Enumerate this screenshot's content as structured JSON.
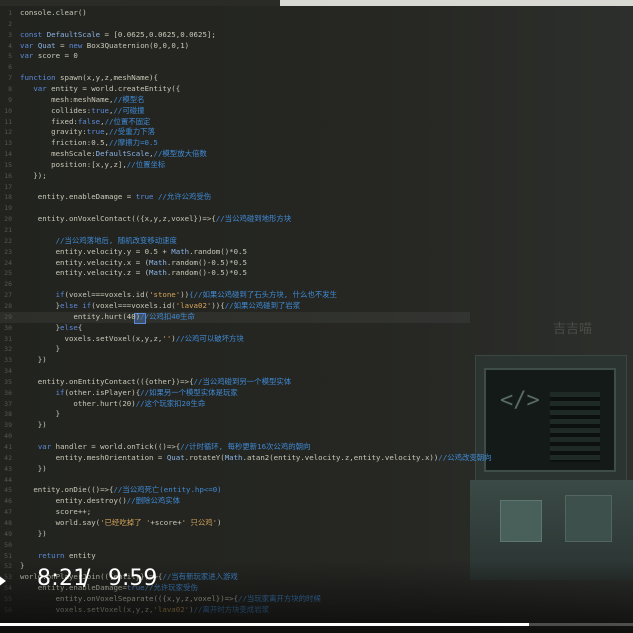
{
  "player": {
    "time_current": "8:21",
    "time_separator": "/",
    "time_total": "9:59",
    "progress_fraction": 0.836
  },
  "watermark": "吉吉喵",
  "editor": {
    "active_line": 29,
    "lines": [
      {
        "n": "1",
        "parts": [
          [
            "",
            "console.clear()"
          ]
        ]
      },
      {
        "n": "2",
        "parts": [
          [
            "",
            ""
          ]
        ]
      },
      {
        "n": "3",
        "parts": [
          [
            "kw",
            "const "
          ],
          [
            "cls",
            "DefaultScale"
          ],
          [
            "",
            "",
            " = [0.0625,0.0625,0.0625];"
          ]
        ]
      },
      {
        "n": "4",
        "parts": [
          [
            "kw",
            "var "
          ],
          [
            "cls",
            "Quat"
          ],
          [
            "",
            " = "
          ],
          [
            "kw",
            "new "
          ],
          [
            "",
            "Box3Quaternion(0,0,0,1)"
          ]
        ]
      },
      {
        "n": "5",
        "parts": [
          [
            "kw",
            "var "
          ],
          [
            "",
            "score = 0"
          ]
        ]
      },
      {
        "n": "6",
        "parts": [
          [
            "",
            ""
          ]
        ]
      },
      {
        "n": "7",
        "parts": [
          [
            "kw",
            "function "
          ],
          [
            "",
            "spawn(x,y,z,meshName){"
          ]
        ]
      },
      {
        "n": "8",
        "parts": [
          [
            "",
            "   "
          ],
          [
            "kw",
            "var "
          ],
          [
            "",
            "entity = world.createEntity({"
          ]
        ]
      },
      {
        "n": "9",
        "parts": [
          [
            "",
            "       mesh:meshName,"
          ],
          [
            "cm",
            "//模型名"
          ]
        ]
      },
      {
        "n": "10",
        "parts": [
          [
            "",
            "       collides:"
          ],
          [
            "kw",
            "true"
          ],
          [
            "",
            ","
          ],
          [
            "cm",
            "//可碰撞"
          ]
        ]
      },
      {
        "n": "11",
        "parts": [
          [
            "",
            "       fixed:"
          ],
          [
            "kw",
            "false"
          ],
          [
            "",
            ","
          ],
          [
            "cm",
            "//位置不固定"
          ]
        ]
      },
      {
        "n": "12",
        "parts": [
          [
            "",
            "       gravity:"
          ],
          [
            "kw",
            "true"
          ],
          [
            "",
            ","
          ],
          [
            "cm",
            "//受重力下落"
          ]
        ]
      },
      {
        "n": "13",
        "parts": [
          [
            "",
            "       friction:0.5,"
          ],
          [
            "cm",
            "//摩擦力=0.5"
          ]
        ]
      },
      {
        "n": "14",
        "parts": [
          [
            "",
            "       meshScale:"
          ],
          [
            "cls",
            "DefaultScale"
          ],
          [
            "",
            ","
          ],
          [
            "cm",
            "//模型放大倍数"
          ]
        ]
      },
      {
        "n": "15",
        "parts": [
          [
            "",
            "       position:[x,y,z],"
          ],
          [
            "cm",
            "//位置坐标"
          ]
        ]
      },
      {
        "n": "16",
        "parts": [
          [
            "",
            "   });"
          ]
        ]
      },
      {
        "n": "17",
        "parts": [
          [
            "",
            ""
          ]
        ]
      },
      {
        "n": "18",
        "parts": [
          [
            "",
            "    entity.enableDamage = "
          ],
          [
            "kw",
            "true "
          ],
          [
            "cm",
            "//允许公鸡受伤"
          ]
        ]
      },
      {
        "n": "19",
        "parts": [
          [
            "",
            ""
          ]
        ]
      },
      {
        "n": "20",
        "parts": [
          [
            "",
            "    entity.onVoxelContact(({x,y,z,voxel})=>{"
          ],
          [
            "cm",
            "//当公鸡碰到地形方块"
          ]
        ]
      },
      {
        "n": "21",
        "parts": [
          [
            "",
            ""
          ]
        ]
      },
      {
        "n": "22",
        "parts": [
          [
            "",
            "        "
          ],
          [
            "cm",
            "//当公鸡落地后, 随机改变移动速度"
          ]
        ]
      },
      {
        "n": "23",
        "parts": [
          [
            "",
            "        entity.velocity.y = 0.5 + "
          ],
          [
            "cls",
            "Math"
          ],
          [
            "",
            ".random()*0.5"
          ]
        ]
      },
      {
        "n": "24",
        "parts": [
          [
            "",
            "        entity.velocity.x = ("
          ],
          [
            "cls",
            "Math"
          ],
          [
            "",
            ".random()-0.5)*0.5"
          ]
        ]
      },
      {
        "n": "25",
        "parts": [
          [
            "",
            "        entity.velocity.z = ("
          ],
          [
            "cls",
            "Math"
          ],
          [
            "",
            ".random()-0.5)*0.5"
          ]
        ]
      },
      {
        "n": "26",
        "parts": [
          [
            "",
            ""
          ]
        ]
      },
      {
        "n": "27",
        "parts": [
          [
            "",
            "        "
          ],
          [
            "kw",
            "if"
          ],
          [
            "",
            "(voxel===voxels.id("
          ],
          [
            "str",
            "'stone'"
          ],
          [
            "",
            "))"
          ],
          [
            "cm",
            "{//如果公鸡碰到了石头方块, 什么也不发生"
          ]
        ]
      },
      {
        "n": "28",
        "parts": [
          [
            "",
            "        }"
          ],
          [
            "kw",
            "else if"
          ],
          [
            "",
            "(voxel===voxels.id("
          ],
          [
            "str",
            "'lava02'"
          ],
          [
            "",
            ")){"
          ],
          [
            "cm",
            "//如果公鸡碰到了岩浆"
          ]
        ]
      },
      {
        "n": "29",
        "parts": [
          [
            "",
            "            entity.hurt(40)"
          ],
          [
            "cm",
            "//公鸡扣40生命"
          ]
        ]
      },
      {
        "n": "30",
        "parts": [
          [
            "",
            "        }"
          ],
          [
            "kw",
            "else"
          ],
          [
            "",
            "{"
          ]
        ]
      },
      {
        "n": "31",
        "parts": [
          [
            "",
            "          voxels.setVoxel(x,y,z,"
          ],
          [
            "str",
            "''"
          ],
          [
            "",
            ")"
          ],
          [
            "cm",
            "//公鸡可以破坏方块"
          ]
        ]
      },
      {
        "n": "32",
        "parts": [
          [
            "",
            "        }"
          ]
        ]
      },
      {
        "n": "33",
        "parts": [
          [
            "",
            "    })"
          ]
        ]
      },
      {
        "n": "34",
        "parts": [
          [
            "",
            ""
          ]
        ]
      },
      {
        "n": "35",
        "parts": [
          [
            "",
            "    entity.onEntityContact(({other})=>{"
          ],
          [
            "cm",
            "//当公鸡碰到另一个模型实体"
          ]
        ]
      },
      {
        "n": "36",
        "parts": [
          [
            "",
            "        "
          ],
          [
            "kw",
            "if"
          ],
          [
            "",
            "(other.isPlayer){"
          ],
          [
            "cm",
            "//如果另一个模型实体是玩家"
          ]
        ]
      },
      {
        "n": "37",
        "parts": [
          [
            "",
            "            other.hurt(20)"
          ],
          [
            "cm",
            "//这个玩家扣20生命"
          ]
        ]
      },
      {
        "n": "38",
        "parts": [
          [
            "",
            "        }"
          ]
        ]
      },
      {
        "n": "39",
        "parts": [
          [
            "",
            "    })"
          ]
        ]
      },
      {
        "n": "40",
        "parts": [
          [
            "",
            ""
          ]
        ]
      },
      {
        "n": "41",
        "parts": [
          [
            "",
            "    "
          ],
          [
            "kw",
            "var "
          ],
          [
            "",
            "handler = world.onTick(()=>{"
          ],
          [
            "cm",
            "//计时循环, 每秒更新16次公鸡的朝向"
          ]
        ]
      },
      {
        "n": "42",
        "parts": [
          [
            "",
            "        entity.meshOrientation = "
          ],
          [
            "cls",
            "Quat"
          ],
          [
            "",
            ".rotateY("
          ],
          [
            "cls",
            "Math"
          ],
          [
            "",
            ".atan2(entity.velocity.z,entity.velocity.x))"
          ],
          [
            "cm",
            "//公鸡改变朝向"
          ]
        ]
      },
      {
        "n": "43",
        "parts": [
          [
            "",
            "    })"
          ]
        ]
      },
      {
        "n": "44",
        "parts": [
          [
            "",
            ""
          ]
        ]
      },
      {
        "n": "45",
        "parts": [
          [
            "",
            "   entity.onDie(()=>{"
          ],
          [
            "cm",
            "//当公鸡死亡(entity.hp<=0)"
          ]
        ]
      },
      {
        "n": "46",
        "parts": [
          [
            "",
            "        entity.destroy()"
          ],
          [
            "cm",
            "//删除公鸡实体"
          ]
        ]
      },
      {
        "n": "47",
        "parts": [
          [
            "",
            "        score++;"
          ]
        ]
      },
      {
        "n": "48",
        "parts": [
          [
            "",
            "        world.say("
          ],
          [
            "str",
            "'已经吃掉了 '"
          ],
          [
            "",
            "+score+"
          ],
          [
            "str",
            "' 只公鸡'"
          ],
          [
            "",
            ")"
          ]
        ]
      },
      {
        "n": "49",
        "parts": [
          [
            "",
            "    })"
          ]
        ]
      },
      {
        "n": "50",
        "parts": [
          [
            "",
            ""
          ]
        ]
      },
      {
        "n": "51",
        "parts": [
          [
            "",
            "    "
          ],
          [
            "kw",
            "return "
          ],
          [
            "",
            "entity"
          ]
        ]
      },
      {
        "n": "52",
        "parts": [
          [
            "",
            "}"
          ]
        ]
      },
      {
        "n": "53",
        "parts": [
          [
            "",
            "world.onPlayerJoin(({entity})=>{"
          ],
          [
            "cm",
            "//当有新玩家进入游戏"
          ]
        ]
      },
      {
        "n": "54",
        "parts": [
          [
            "",
            "    entity.enableDamage="
          ],
          [
            "kw",
            "true"
          ],
          [
            "cm",
            "//允许玩家受伤"
          ]
        ]
      },
      {
        "n": "55",
        "parts": [
          [
            "",
            "        entity.onVoxelSeparate(({x,y,z,voxel})=>{"
          ],
          [
            "cm",
            "//当玩家离开方块的时候"
          ]
        ]
      },
      {
        "n": "56",
        "parts": [
          [
            "",
            "        voxels.setVoxel(x,y,z,"
          ],
          [
            "str",
            "'lava02'"
          ],
          [
            "",
            ")"
          ],
          [
            "cm",
            "//离开时方块变成岩浆"
          ]
        ]
      }
    ]
  }
}
